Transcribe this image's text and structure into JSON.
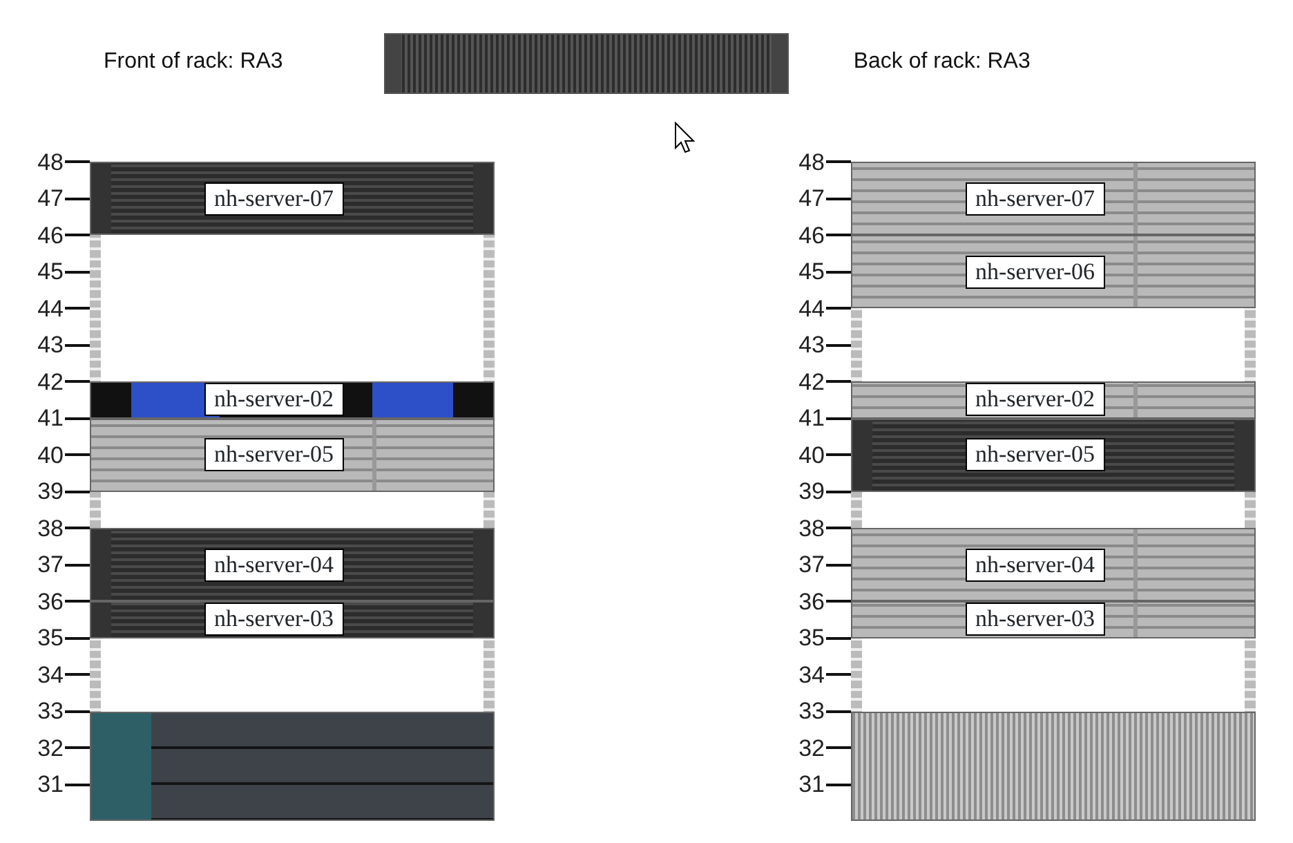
{
  "header": {
    "front_title": "Front of rack: RA3",
    "back_title": "Back of rack: RA3"
  },
  "racks": [
    {
      "scale": [
        "48",
        "47",
        "46",
        "45",
        "44",
        "43",
        "42",
        "41",
        "40",
        "39",
        "38",
        "37",
        "36",
        "35",
        "34",
        "33",
        "32",
        "31"
      ],
      "slots": [
        {
          "kind": "server",
          "label": "nh-server-07"
        },
        {
          "kind": "empty"
        },
        {
          "kind": "empty"
        },
        {
          "kind": "empty"
        },
        {
          "kind": "empty"
        },
        {
          "kind": "firewall",
          "label": "nh-server-02"
        },
        {
          "kind": "blade",
          "label": "nh-server-05"
        },
        {
          "kind": "empty"
        },
        {
          "kind": "server",
          "label": "nh-server-04"
        },
        {
          "kind": "slimserver",
          "label": "nh-server-03"
        },
        {
          "kind": "empty"
        },
        {
          "kind": "empty"
        },
        {
          "kind": "shelf"
        }
      ]
    },
    {
      "scale": [
        "48",
        "47",
        "46",
        "45",
        "44",
        "43",
        "42",
        "41",
        "40",
        "39",
        "38",
        "37",
        "36",
        "35",
        "34",
        "33",
        "32",
        "31"
      ],
      "slots": [
        {
          "kind": "blade",
          "label": "nh-server-07"
        },
        {
          "kind": "blade",
          "label": "nh-server-06"
        },
        {
          "kind": "empty"
        },
        {
          "kind": "empty"
        },
        {
          "kind": "slimblade",
          "label": "nh-server-02"
        },
        {
          "kind": "server",
          "label": "nh-server-05"
        },
        {
          "kind": "empty"
        },
        {
          "kind": "blade",
          "label": "nh-server-04"
        },
        {
          "kind": "slimblade",
          "label": "nh-server-03"
        },
        {
          "kind": "empty"
        },
        {
          "kind": "empty"
        },
        {
          "kind": "enclosure"
        }
      ]
    }
  ]
}
